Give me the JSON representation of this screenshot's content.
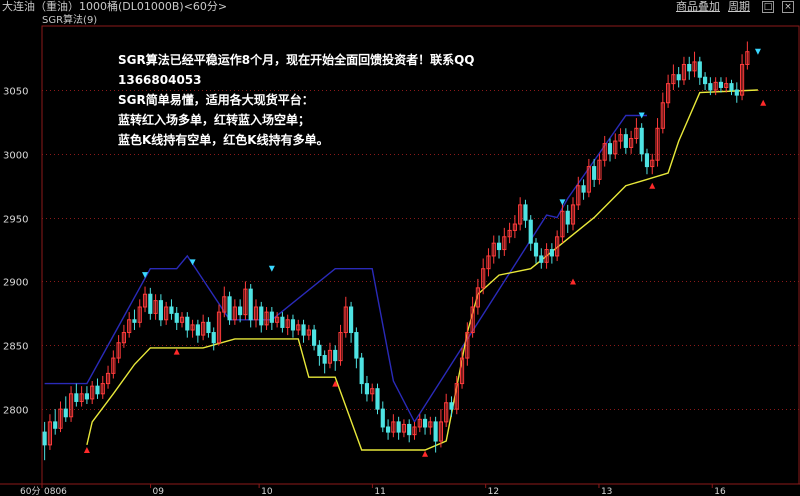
{
  "header": {
    "title": "大连油（重油）1000桶(DL01000B)<60分>",
    "add_product": "商品叠加",
    "period": "周期"
  },
  "indicator_label": "SGR算法(9)",
  "annotations": [
    "SGR算法已经平稳运作8个月，现在开始全面回馈投资者！联系QQ",
    "1366804053",
    "SGR简单易懂，适用各大现货平台：",
    "蓝转红入场多单，红转蓝入场空单；",
    "蓝色K线持有空单，红色K线持有多单。"
  ],
  "axis": {
    "y_ticks": [
      3050,
      3000,
      2950,
      2900,
      2850,
      2800
    ],
    "period_label": "60分",
    "x_ticks": [
      "0806",
      "09",
      "10",
      "11",
      "12",
      "13",
      "16"
    ]
  },
  "chart_data": {
    "type": "candlestick",
    "ylim": [
      2752,
      3093
    ],
    "colors": {
      "up": "#ff3b3b",
      "down": "#4fe3e3",
      "support": "#e8e83a",
      "resistance": "#2a2ab8",
      "grid": "#8b1a1a"
    },
    "candles": [
      [
        2782,
        2772,
        2790,
        2760
      ],
      [
        2772,
        2790,
        2796,
        2768
      ],
      [
        2790,
        2785,
        2800,
        2780
      ],
      [
        2785,
        2800,
        2806,
        2782
      ],
      [
        2800,
        2794,
        2810,
        2790
      ],
      [
        2794,
        2812,
        2818,
        2790
      ],
      [
        2812,
        2806,
        2820,
        2802
      ],
      [
        2806,
        2812,
        2818,
        2802
      ],
      [
        2812,
        2808,
        2818,
        2804
      ],
      [
        2808,
        2818,
        2822,
        2804
      ],
      [
        2818,
        2812,
        2824,
        2808
      ],
      [
        2812,
        2820,
        2826,
        2808
      ],
      [
        2820,
        2828,
        2834,
        2816
      ],
      [
        2828,
        2840,
        2846,
        2824
      ],
      [
        2840,
        2852,
        2858,
        2836
      ],
      [
        2852,
        2860,
        2866,
        2848
      ],
      [
        2860,
        2870,
        2876,
        2856
      ],
      [
        2870,
        2868,
        2878,
        2862
      ],
      [
        2868,
        2880,
        2886,
        2864
      ],
      [
        2880,
        2890,
        2896,
        2876
      ],
      [
        2890,
        2875,
        2895,
        2870
      ],
      [
        2875,
        2885,
        2890,
        2870
      ],
      [
        2885,
        2870,
        2890,
        2865
      ],
      [
        2870,
        2880,
        2884,
        2866
      ],
      [
        2880,
        2875,
        2886,
        2870
      ],
      [
        2875,
        2868,
        2880,
        2862
      ],
      [
        2868,
        2872,
        2876,
        2864
      ],
      [
        2872,
        2862,
        2876,
        2856
      ],
      [
        2862,
        2866,
        2870,
        2856
      ],
      [
        2866,
        2858,
        2870,
        2852
      ],
      [
        2858,
        2868,
        2874,
        2854
      ],
      [
        2868,
        2860,
        2872,
        2856
      ],
      [
        2860,
        2852,
        2864,
        2846
      ],
      [
        2852,
        2876,
        2882,
        2850
      ],
      [
        2876,
        2888,
        2896,
        2872
      ],
      [
        2888,
        2870,
        2892,
        2866
      ],
      [
        2870,
        2880,
        2886,
        2866
      ],
      [
        2880,
        2874,
        2886,
        2868
      ],
      [
        2874,
        2894,
        2900,
        2870
      ],
      [
        2894,
        2870,
        2898,
        2864
      ],
      [
        2870,
        2880,
        2886,
        2864
      ],
      [
        2880,
        2866,
        2884,
        2860
      ],
      [
        2866,
        2876,
        2880,
        2862
      ],
      [
        2876,
        2868,
        2880,
        2862
      ],
      [
        2868,
        2872,
        2876,
        2864
      ],
      [
        2872,
        2864,
        2876,
        2860
      ],
      [
        2864,
        2870,
        2874,
        2858
      ],
      [
        2870,
        2862,
        2874,
        2856
      ],
      [
        2862,
        2866,
        2870,
        2858
      ],
      [
        2866,
        2858,
        2870,
        2852
      ],
      [
        2858,
        2862,
        2866,
        2854
      ],
      [
        2862,
        2850,
        2866,
        2846
      ],
      [
        2850,
        2842,
        2854,
        2834
      ],
      [
        2842,
        2836,
        2846,
        2828
      ],
      [
        2836,
        2846,
        2852,
        2832
      ],
      [
        2846,
        2838,
        2850,
        2830
      ],
      [
        2838,
        2860,
        2866,
        2834
      ],
      [
        2860,
        2880,
        2888,
        2856
      ],
      [
        2880,
        2860,
        2884,
        2852
      ],
      [
        2860,
        2840,
        2864,
        2832
      ],
      [
        2840,
        2820,
        2844,
        2812
      ],
      [
        2820,
        2812,
        2826,
        2806
      ],
      [
        2812,
        2816,
        2820,
        2806
      ],
      [
        2816,
        2800,
        2820,
        2796
      ],
      [
        2800,
        2786,
        2806,
        2782
      ],
      [
        2786,
        2782,
        2792,
        2776
      ],
      [
        2782,
        2790,
        2796,
        2778
      ],
      [
        2790,
        2782,
        2794,
        2776
      ],
      [
        2782,
        2788,
        2792,
        2778
      ],
      [
        2788,
        2780,
        2792,
        2774
      ],
      [
        2780,
        2786,
        2790,
        2776
      ],
      [
        2786,
        2792,
        2796,
        2782
      ],
      [
        2792,
        2786,
        2796,
        2780
      ],
      [
        2786,
        2790,
        2794,
        2780
      ],
      [
        2790,
        2775,
        2794,
        2766
      ],
      [
        2775,
        2790,
        2800,
        2770
      ],
      [
        2790,
        2805,
        2812,
        2786
      ],
      [
        2805,
        2800,
        2810,
        2794
      ],
      [
        2800,
        2820,
        2826,
        2796
      ],
      [
        2820,
        2840,
        2848,
        2816
      ],
      [
        2840,
        2860,
        2868,
        2834
      ],
      [
        2860,
        2880,
        2888,
        2856
      ],
      [
        2880,
        2895,
        2902,
        2874
      ],
      [
        2895,
        2910,
        2918,
        2890
      ],
      [
        2910,
        2920,
        2926,
        2904
      ],
      [
        2920,
        2930,
        2936,
        2914
      ],
      [
        2930,
        2925,
        2936,
        2918
      ],
      [
        2925,
        2935,
        2942,
        2920
      ],
      [
        2935,
        2940,
        2946,
        2930
      ],
      [
        2940,
        2945,
        2952,
        2934
      ],
      [
        2945,
        2960,
        2966,
        2940
      ],
      [
        2960,
        2948,
        2964,
        2942
      ],
      [
        2948,
        2930,
        2952,
        2924
      ],
      [
        2930,
        2920,
        2934,
        2914
      ],
      [
        2920,
        2915,
        2926,
        2910
      ],
      [
        2915,
        2925,
        2930,
        2910
      ],
      [
        2925,
        2920,
        2930,
        2914
      ],
      [
        2920,
        2935,
        2940,
        2916
      ],
      [
        2935,
        2955,
        2962,
        2930
      ],
      [
        2955,
        2945,
        2960,
        2938
      ],
      [
        2945,
        2960,
        2966,
        2940
      ],
      [
        2960,
        2975,
        2982,
        2956
      ],
      [
        2975,
        2970,
        2980,
        2964
      ],
      [
        2970,
        2990,
        2996,
        2966
      ],
      [
        2990,
        2980,
        2996,
        2974
      ],
      [
        2980,
        2995,
        3000,
        2976
      ],
      [
        2995,
        3008,
        3014,
        2990
      ],
      [
        3008,
        3000,
        3012,
        2994
      ],
      [
        3000,
        3010,
        3016,
        2996
      ],
      [
        3010,
        3015,
        3020,
        3004
      ],
      [
        3015,
        3005,
        3020,
        3000
      ],
      [
        3005,
        3012,
        3018,
        3000
      ],
      [
        3012,
        3020,
        3028,
        3008
      ],
      [
        3020,
        3000,
        3024,
        2994
      ],
      [
        3000,
        2990,
        3004,
        2984
      ],
      [
        2990,
        2995,
        3000,
        2984
      ],
      [
        2995,
        3020,
        3028,
        2990
      ],
      [
        3020,
        3040,
        3048,
        3016
      ],
      [
        3040,
        3055,
        3062,
        3036
      ],
      [
        3055,
        3062,
        3070,
        3050
      ],
      [
        3062,
        3058,
        3068,
        3052
      ],
      [
        3058,
        3070,
        3076,
        3054
      ],
      [
        3070,
        3065,
        3076,
        3058
      ],
      [
        3065,
        3072,
        3080,
        3060
      ],
      [
        3072,
        3060,
        3076,
        3054
      ],
      [
        3060,
        3055,
        3064,
        3050
      ],
      [
        3055,
        3050,
        3060,
        3046
      ],
      [
        3050,
        3056,
        3060,
        3046
      ],
      [
        3056,
        3052,
        3060,
        3048
      ],
      [
        3052,
        3055,
        3060,
        3048
      ],
      [
        3055,
        3050,
        3058,
        3046
      ],
      [
        3050,
        3046,
        3056,
        3040
      ],
      [
        3046,
        3070,
        3078,
        3042
      ],
      [
        3070,
        3080,
        3088,
        3066
      ]
    ],
    "support_line": [
      [
        8,
        2772
      ],
      [
        9,
        2790
      ],
      [
        13,
        2812
      ],
      [
        17,
        2835
      ],
      [
        20,
        2848
      ],
      [
        26,
        2848
      ],
      [
        30,
        2848
      ],
      [
        36,
        2855
      ],
      [
        44,
        2855
      ],
      [
        48,
        2855
      ],
      [
        50,
        2825
      ],
      [
        53,
        2825
      ],
      [
        55,
        2825
      ],
      [
        60,
        2768
      ],
      [
        72,
        2768
      ],
      [
        76,
        2775
      ],
      [
        80,
        2860
      ],
      [
        82,
        2890
      ],
      [
        86,
        2905
      ],
      [
        92,
        2910
      ],
      [
        98,
        2930
      ],
      [
        104,
        2950
      ],
      [
        110,
        2975
      ],
      [
        114,
        2980
      ],
      [
        118,
        2985
      ],
      [
        120,
        3010
      ],
      [
        124,
        3048
      ],
      [
        135,
        3050
      ]
    ],
    "resistance_line": [
      [
        0,
        2820
      ],
      [
        8,
        2820
      ],
      [
        20,
        2910
      ],
      [
        25,
        2910
      ],
      [
        27,
        2920
      ],
      [
        35,
        2870
      ],
      [
        43,
        2870
      ],
      [
        55,
        2910
      ],
      [
        62,
        2910
      ],
      [
        66,
        2822
      ],
      [
        70,
        2790
      ],
      [
        95,
        2952
      ],
      [
        97,
        2950
      ],
      [
        99,
        2965
      ],
      [
        110,
        3030
      ],
      [
        114,
        3030
      ]
    ],
    "buy_signals": [
      [
        8,
        2768
      ],
      [
        25,
        2845
      ],
      [
        55,
        2820
      ],
      [
        72,
        2765
      ],
      [
        100,
        2900
      ],
      [
        115,
        2975
      ],
      [
        136,
        3040
      ]
    ],
    "sell_signals": [
      [
        19,
        2905
      ],
      [
        28,
        2915
      ],
      [
        43,
        2910
      ],
      [
        98,
        2962
      ],
      [
        113,
        3030
      ],
      [
        135,
        3080
      ]
    ]
  }
}
